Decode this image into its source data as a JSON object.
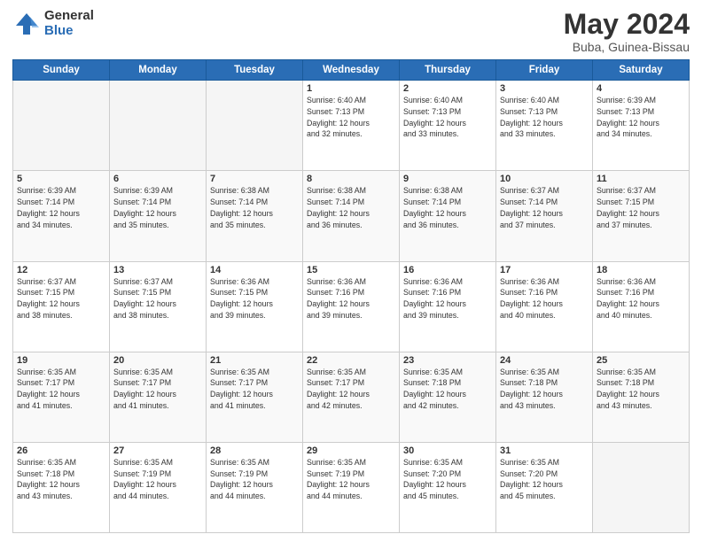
{
  "header": {
    "logo_general": "General",
    "logo_blue": "Blue",
    "title": "May 2024",
    "location": "Buba, Guinea-Bissau"
  },
  "days_of_week": [
    "Sunday",
    "Monday",
    "Tuesday",
    "Wednesday",
    "Thursday",
    "Friday",
    "Saturday"
  ],
  "weeks": [
    [
      {
        "num": "",
        "info": ""
      },
      {
        "num": "",
        "info": ""
      },
      {
        "num": "",
        "info": ""
      },
      {
        "num": "1",
        "info": "Sunrise: 6:40 AM\nSunset: 7:13 PM\nDaylight: 12 hours\nand 32 minutes."
      },
      {
        "num": "2",
        "info": "Sunrise: 6:40 AM\nSunset: 7:13 PM\nDaylight: 12 hours\nand 33 minutes."
      },
      {
        "num": "3",
        "info": "Sunrise: 6:40 AM\nSunset: 7:13 PM\nDaylight: 12 hours\nand 33 minutes."
      },
      {
        "num": "4",
        "info": "Sunrise: 6:39 AM\nSunset: 7:13 PM\nDaylight: 12 hours\nand 34 minutes."
      }
    ],
    [
      {
        "num": "5",
        "info": "Sunrise: 6:39 AM\nSunset: 7:14 PM\nDaylight: 12 hours\nand 34 minutes."
      },
      {
        "num": "6",
        "info": "Sunrise: 6:39 AM\nSunset: 7:14 PM\nDaylight: 12 hours\nand 35 minutes."
      },
      {
        "num": "7",
        "info": "Sunrise: 6:38 AM\nSunset: 7:14 PM\nDaylight: 12 hours\nand 35 minutes."
      },
      {
        "num": "8",
        "info": "Sunrise: 6:38 AM\nSunset: 7:14 PM\nDaylight: 12 hours\nand 36 minutes."
      },
      {
        "num": "9",
        "info": "Sunrise: 6:38 AM\nSunset: 7:14 PM\nDaylight: 12 hours\nand 36 minutes."
      },
      {
        "num": "10",
        "info": "Sunrise: 6:37 AM\nSunset: 7:14 PM\nDaylight: 12 hours\nand 37 minutes."
      },
      {
        "num": "11",
        "info": "Sunrise: 6:37 AM\nSunset: 7:15 PM\nDaylight: 12 hours\nand 37 minutes."
      }
    ],
    [
      {
        "num": "12",
        "info": "Sunrise: 6:37 AM\nSunset: 7:15 PM\nDaylight: 12 hours\nand 38 minutes."
      },
      {
        "num": "13",
        "info": "Sunrise: 6:37 AM\nSunset: 7:15 PM\nDaylight: 12 hours\nand 38 minutes."
      },
      {
        "num": "14",
        "info": "Sunrise: 6:36 AM\nSunset: 7:15 PM\nDaylight: 12 hours\nand 39 minutes."
      },
      {
        "num": "15",
        "info": "Sunrise: 6:36 AM\nSunset: 7:16 PM\nDaylight: 12 hours\nand 39 minutes."
      },
      {
        "num": "16",
        "info": "Sunrise: 6:36 AM\nSunset: 7:16 PM\nDaylight: 12 hours\nand 39 minutes."
      },
      {
        "num": "17",
        "info": "Sunrise: 6:36 AM\nSunset: 7:16 PM\nDaylight: 12 hours\nand 40 minutes."
      },
      {
        "num": "18",
        "info": "Sunrise: 6:36 AM\nSunset: 7:16 PM\nDaylight: 12 hours\nand 40 minutes."
      }
    ],
    [
      {
        "num": "19",
        "info": "Sunrise: 6:35 AM\nSunset: 7:17 PM\nDaylight: 12 hours\nand 41 minutes."
      },
      {
        "num": "20",
        "info": "Sunrise: 6:35 AM\nSunset: 7:17 PM\nDaylight: 12 hours\nand 41 minutes."
      },
      {
        "num": "21",
        "info": "Sunrise: 6:35 AM\nSunset: 7:17 PM\nDaylight: 12 hours\nand 41 minutes."
      },
      {
        "num": "22",
        "info": "Sunrise: 6:35 AM\nSunset: 7:17 PM\nDaylight: 12 hours\nand 42 minutes."
      },
      {
        "num": "23",
        "info": "Sunrise: 6:35 AM\nSunset: 7:18 PM\nDaylight: 12 hours\nand 42 minutes."
      },
      {
        "num": "24",
        "info": "Sunrise: 6:35 AM\nSunset: 7:18 PM\nDaylight: 12 hours\nand 43 minutes."
      },
      {
        "num": "25",
        "info": "Sunrise: 6:35 AM\nSunset: 7:18 PM\nDaylight: 12 hours\nand 43 minutes."
      }
    ],
    [
      {
        "num": "26",
        "info": "Sunrise: 6:35 AM\nSunset: 7:18 PM\nDaylight: 12 hours\nand 43 minutes."
      },
      {
        "num": "27",
        "info": "Sunrise: 6:35 AM\nSunset: 7:19 PM\nDaylight: 12 hours\nand 44 minutes."
      },
      {
        "num": "28",
        "info": "Sunrise: 6:35 AM\nSunset: 7:19 PM\nDaylight: 12 hours\nand 44 minutes."
      },
      {
        "num": "29",
        "info": "Sunrise: 6:35 AM\nSunset: 7:19 PM\nDaylight: 12 hours\nand 44 minutes."
      },
      {
        "num": "30",
        "info": "Sunrise: 6:35 AM\nSunset: 7:20 PM\nDaylight: 12 hours\nand 45 minutes."
      },
      {
        "num": "31",
        "info": "Sunrise: 6:35 AM\nSunset: 7:20 PM\nDaylight: 12 hours\nand 45 minutes."
      },
      {
        "num": "",
        "info": ""
      }
    ]
  ]
}
